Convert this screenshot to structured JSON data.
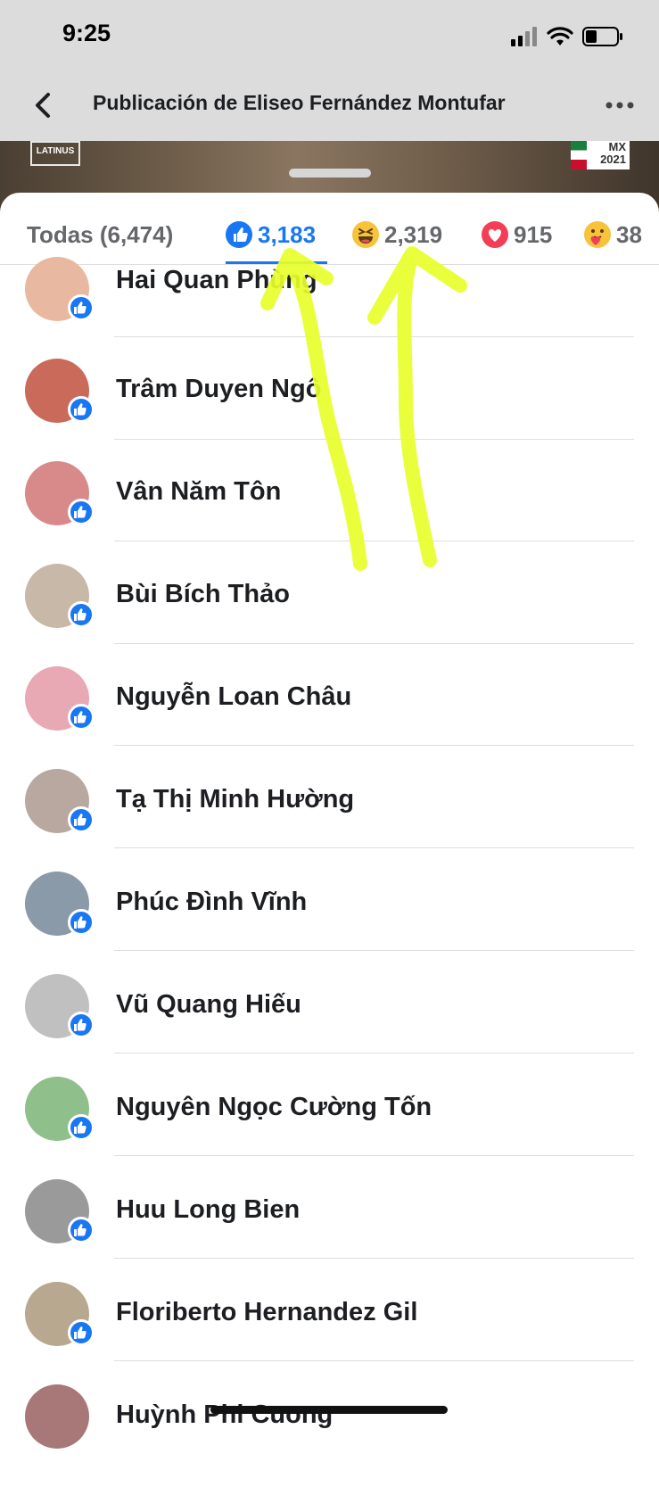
{
  "status_bar": {
    "time": "9:25"
  },
  "nav": {
    "title": "Publicación de Eliseo Fernández Montufar"
  },
  "backdrop": {
    "logo_text": "LATINUS",
    "badge_top": "MX",
    "badge_year": "2021"
  },
  "reaction_tabs": [
    {
      "label": "Todas (6,474)",
      "icon": "",
      "active": false
    },
    {
      "label": "3,183",
      "icon": "like-icon",
      "active": true
    },
    {
      "label": "2,319",
      "icon": "haha-icon",
      "active": false
    },
    {
      "label": "915",
      "icon": "love-icon",
      "active": false
    },
    {
      "label": "38",
      "icon": "care-icon",
      "active": false
    }
  ],
  "people": [
    {
      "name": "Hai Quan Phùng",
      "avatar_color": "#e9b8a0"
    },
    {
      "name": "Trâm Duyen Ngô",
      "avatar_color": "#c96a5a"
    },
    {
      "name": "Vân Năm Tôn",
      "avatar_color": "#d88a8a"
    },
    {
      "name": "Bùi Bích Thảo",
      "avatar_color": "#c8b8a8"
    },
    {
      "name": "Nguyễn Loan Châu",
      "avatar_color": "#e8a8b4"
    },
    {
      "name": "Tạ Thị Minh Hường",
      "avatar_color": "#b8a8a0"
    },
    {
      "name": "Phúc Đình Vĩnh",
      "avatar_color": "#8a9aa8"
    },
    {
      "name": "Vũ Quang Hiếu",
      "avatar_color": "#c0c0c0"
    },
    {
      "name": "Nguyên Ngọc Cường Tốn",
      "avatar_color": "#8fbf8a"
    },
    {
      "name": "Huu Long Bien",
      "avatar_color": "#9a9a9a"
    },
    {
      "name": "Floriberto Hernandez Gil",
      "avatar_color": "#b8a890"
    },
    {
      "name": "Huỳnh Phi Cuong",
      "avatar_color": "#a87878"
    }
  ],
  "colors": {
    "accent": "#1877f2",
    "annotation": "#e8ff2a"
  }
}
